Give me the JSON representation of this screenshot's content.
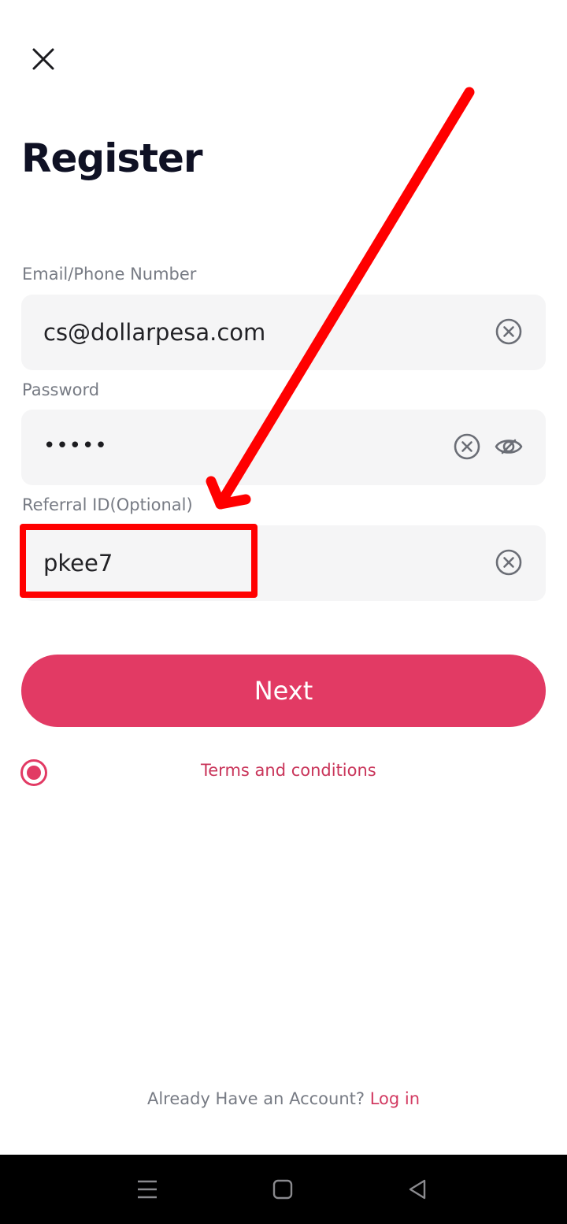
{
  "header": {
    "title": "Register"
  },
  "form": {
    "email": {
      "label": "Email/Phone Number",
      "value": "cs@dollarpesa.com"
    },
    "password": {
      "label": "Password",
      "masked_value": "•••••"
    },
    "referral": {
      "label": "Referral ID(Optional)",
      "value": "pkee7"
    }
  },
  "actions": {
    "next_label": "Next",
    "terms_label": "Terms and conditions",
    "terms_checked": true
  },
  "footer": {
    "prompt": "Already Have an Account?",
    "login_label": "Log in"
  },
  "icons": {
    "close": "close-icon",
    "clear": "clear-circle-icon",
    "visibility": "eye-off-icon",
    "nav_menu": "menu-icon",
    "nav_home": "home-square-icon",
    "nav_back": "back-triangle-icon"
  },
  "colors": {
    "accent": "#e23a64",
    "annotation": "#ff0000",
    "title": "#0f1124",
    "label": "#777b84",
    "field_bg": "#f5f5f6"
  }
}
